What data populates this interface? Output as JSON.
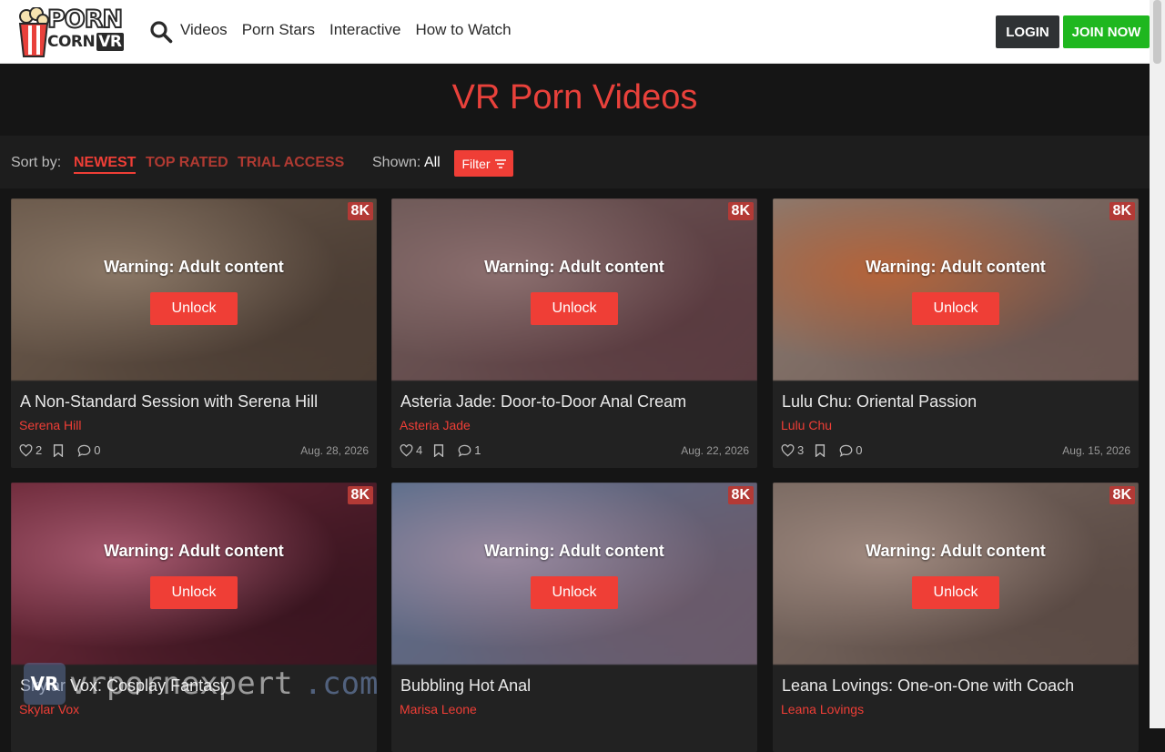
{
  "header": {
    "logo_line1": "PORN",
    "logo_line2": "CORN",
    "logo_line3": "VR",
    "nav": [
      "Videos",
      "Porn Stars",
      "Interactive",
      "How to Watch"
    ],
    "login_label": "LOGIN",
    "join_label": "JOIN NOW"
  },
  "page_title": "VR Porn Videos",
  "sortbar": {
    "label": "Sort by:",
    "options": [
      "NEWEST",
      "TOP RATED",
      "TRIAL ACCESS"
    ],
    "shown_label": "Shown:",
    "shown_value": "All",
    "filter_label": "Filter"
  },
  "card_common": {
    "badge": "8K",
    "warning": "Warning: Adult content",
    "unlock": "Unlock"
  },
  "cards": [
    {
      "title": "A Non-Standard Session with Serena Hill",
      "star": "Serena Hill",
      "likes": "2",
      "comments": "0",
      "date": "Aug. 28, 2026",
      "colors": [
        "#6b5a4c",
        "#8a7766",
        "#4a3c33"
      ]
    },
    {
      "title": "Asteria Jade: Door-to-Door Anal Cream",
      "star": "Asteria Jade",
      "likes": "4",
      "comments": "1",
      "date": "Aug. 22, 2026",
      "colors": [
        "#6e5a58",
        "#8c6f6f",
        "#5a3b40"
      ]
    },
    {
      "title": "Lulu Chu: Oriental Passion",
      "star": "Lulu Chu",
      "likes": "3",
      "comments": "0",
      "date": "Aug. 15, 2026",
      "colors": [
        "#8a7a70",
        "#b5643a",
        "#6a5550"
      ]
    },
    {
      "title": "Skylar Vox: Cosplay Fantasy",
      "star": "Skylar Vox",
      "likes": "",
      "comments": "",
      "date": "",
      "colors": [
        "#6e2a3a",
        "#a85a70",
        "#3a1520"
      ]
    },
    {
      "title": "Bubbling Hot Anal",
      "star": "Marisa Leone",
      "likes": "",
      "comments": "",
      "date": "",
      "colors": [
        "#5a6e8c",
        "#9a8aa0",
        "#6a5a6a"
      ]
    },
    {
      "title": "Leana Lovings: One-on-One with Coach",
      "star": "Leana Lovings",
      "likes": "",
      "comments": "",
      "date": "",
      "colors": [
        "#7a6a62",
        "#a08a80",
        "#5a4a44"
      ]
    }
  ],
  "watermark": {
    "box": "VR",
    "text": "vrpornexpert",
    "suffix": ".com"
  }
}
